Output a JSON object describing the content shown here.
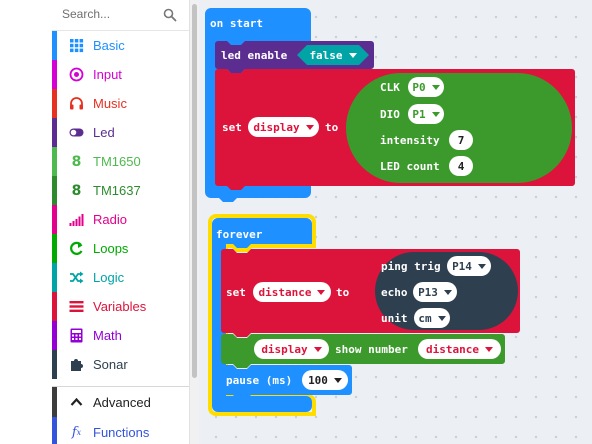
{
  "toolbox": {
    "search_placeholder": "Search...",
    "categories": [
      {
        "label": "Basic",
        "color": "#1e90ff",
        "icon": "grid-icon"
      },
      {
        "label": "Input",
        "color": "#d400d4",
        "icon": "radio-target-icon"
      },
      {
        "label": "Music",
        "color": "#e63022",
        "icon": "headphones-icon"
      },
      {
        "label": "Led",
        "color": "#5c2d91",
        "icon": "toggle-icon"
      },
      {
        "label": "TM1650",
        "color": "#4eb94e",
        "icon": "digit-8-icon"
      },
      {
        "label": "TM1637",
        "color": "#2d8b2d",
        "icon": "digit-8-icon"
      },
      {
        "label": "Radio",
        "color": "#e3008c",
        "icon": "signal-bars-icon"
      },
      {
        "label": "Loops",
        "color": "#00aa00",
        "icon": "loop-arrow-icon"
      },
      {
        "label": "Logic",
        "color": "#00a4a6",
        "icon": "shuffle-icon"
      },
      {
        "label": "Variables",
        "color": "#dc143c",
        "icon": "lines-icon"
      },
      {
        "label": "Math",
        "color": "#9400d3",
        "icon": "calculator-icon"
      },
      {
        "label": "Sonar",
        "color": "#2e3f50",
        "icon": "puzzle-icon"
      }
    ],
    "advanced": {
      "label": "Advanced",
      "color": "#3c3c3c",
      "icon": "chevron-up-icon"
    },
    "functions": {
      "label": "Functions",
      "color": "#3455db",
      "icon": "fx-icon"
    }
  },
  "blocks": {
    "on_start": {
      "hat_label": "on start",
      "led_enable_label": "led enable",
      "led_enable_value": "false",
      "set_label": "set",
      "set_variable": "display",
      "to_label": "to",
      "clk_label": "CLK",
      "clk_value": "P0",
      "dio_label": "DIO",
      "dio_value": "P1",
      "intensity_label": "intensity",
      "intensity_value": "7",
      "led_count_label": "LED count",
      "led_count_value": "4"
    },
    "forever": {
      "hat_label": "forever",
      "set_label": "set",
      "set_variable": "distance",
      "to_label": "to",
      "ping_label": "ping trig",
      "trig_value": "P14",
      "echo_label": "echo",
      "echo_value": "P13",
      "unit_label": "unit",
      "unit_value": "cm",
      "display_variable": "display",
      "show_number_label": "show number",
      "show_number_value": "distance",
      "pause_label": "pause (ms)",
      "pause_value": "100"
    }
  },
  "colors": {
    "basic": "#1e90ff",
    "variables": "#dc143c",
    "led": "#5c2d91",
    "logic": "#00a4a6",
    "tm1637": "#3c9a2c",
    "sonar": "#2e3f50",
    "highlight": "#ffdd00"
  }
}
